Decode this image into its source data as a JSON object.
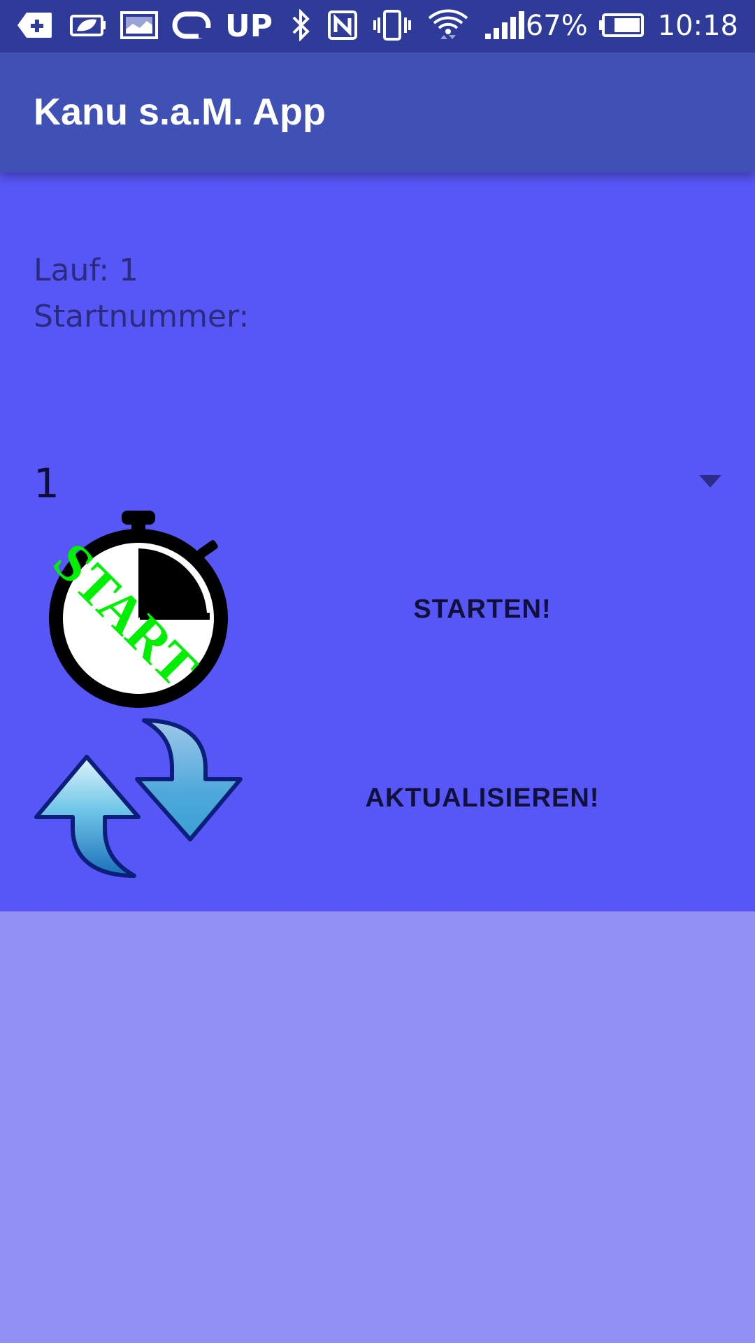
{
  "status_bar": {
    "up_label": "UP",
    "battery_percent": "67%",
    "time": "10:18",
    "icons": [
      "add-notification-icon",
      "battery-saver-icon",
      "image-icon",
      "sync-icon",
      "bluetooth-icon",
      "nfc-icon",
      "vibrate-icon",
      "wifi-icon",
      "signal-icon",
      "battery-icon"
    ]
  },
  "toolbar": {
    "title": "Kanu s.a.M. App"
  },
  "info": {
    "lauf_label": "Lauf: 1",
    "startnummer_label": "Startnummer:"
  },
  "spinner": {
    "selected_value": "1"
  },
  "actions": {
    "start_label": "STARTEN!",
    "refresh_label": "AKTUALISIEREN!",
    "start_image_text": "START"
  },
  "colors": {
    "status_bar": "#2f3b99",
    "toolbar": "#3f51b5",
    "content": "#5757f7",
    "page": "#9191f3",
    "start_text": "#00ee00"
  }
}
